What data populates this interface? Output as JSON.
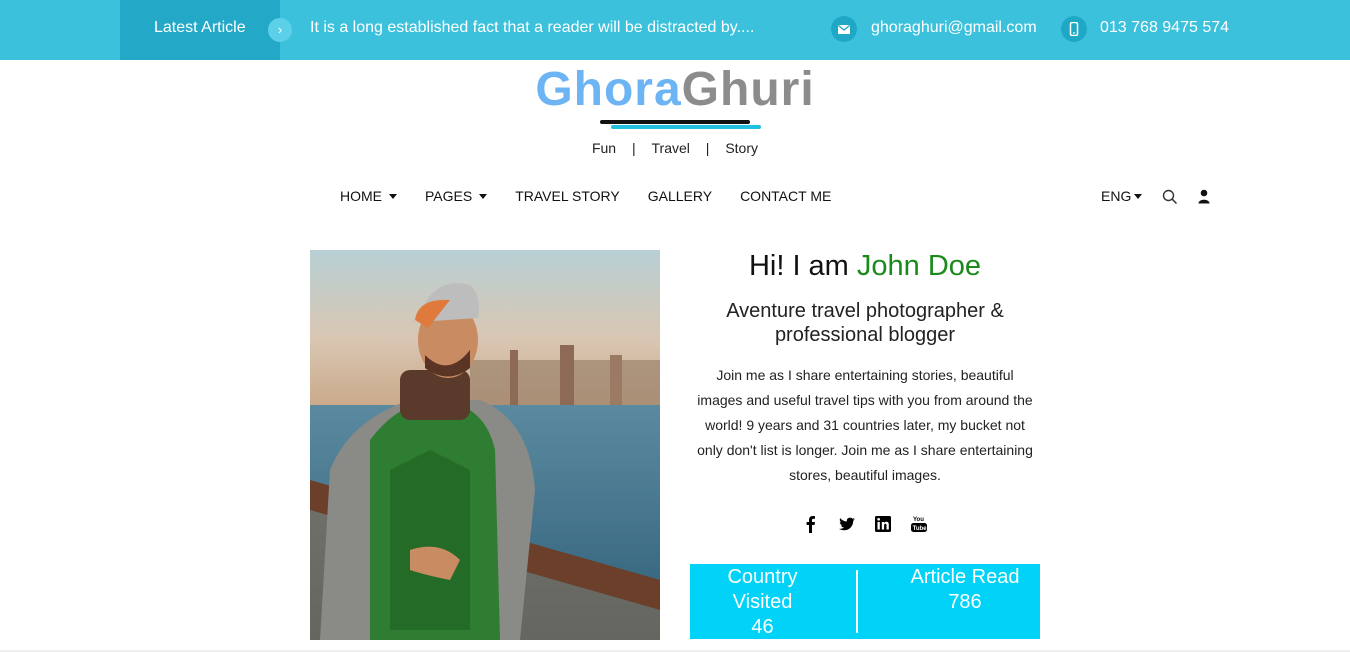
{
  "topbar": {
    "latest_label": "Latest Article",
    "arrow": "›",
    "latest_text": "It is a long established fact that a reader will be distracted by....",
    "email": "ghoraghuri@gmail.com",
    "phone": "013 768 9475 574",
    "email_icon": "mail-icon",
    "phone_icon": "mobile-icon"
  },
  "logo": {
    "part1": "Ghora",
    "part2": "Ghuri"
  },
  "tagline": {
    "item1": "Fun",
    "sep": "|",
    "item2": "Travel",
    "item3": "Story"
  },
  "nav": {
    "home": "HOME",
    "pages": "PAGES",
    "travel_story": "TRAVEL STORY",
    "gallery": "GALLERY",
    "contact": "CONTACT ME",
    "lang": "ENG"
  },
  "about": {
    "greeting": "Hi! I am ",
    "name": "John Doe",
    "subtitle": "Aventure travel photographer & professional blogger",
    "bio": "Join me as I share entertaining stories, beautiful images and useful travel tips with you from around the world! 9 years and 31 countries later, my bucket not only don't list is longer. Join me as I share entertaining stores, beautiful images."
  },
  "social": [
    "facebook-icon",
    "twitter-icon",
    "linkedin-icon",
    "youtube-icon"
  ],
  "stats": {
    "left_label": "Country Visited",
    "left_value": "46",
    "right_label": "Article Read",
    "right_value": "786"
  },
  "colors": {
    "topbar": "#3cc1dc",
    "latest_box": "#23a9c7",
    "logo_blue": "#6cb4f3",
    "logo_gray": "#8c8c8c",
    "name_green": "#1a8a1a",
    "stats_bg": "#00d3f7"
  }
}
